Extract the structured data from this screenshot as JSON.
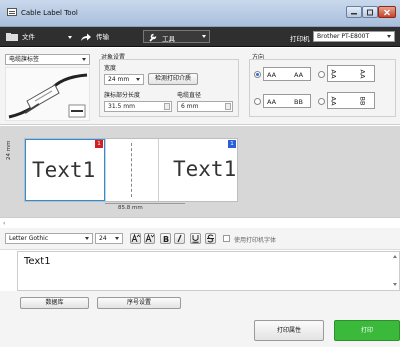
{
  "window": {
    "title": "Cable Label Tool"
  },
  "toolbar": {
    "file_label": "文件",
    "send_label": "传输",
    "tools_label": "工具",
    "printer_caption": "打印机",
    "printer_value": "Brother PT-E800T"
  },
  "settings": {
    "label_type": "电缆旗标签",
    "object_group_label": "对象设置",
    "width_label": "宽度",
    "width_value": "24 mm",
    "detect_button": "检测打印介质",
    "flag_length_label": "旗标部分长度",
    "flag_length_value": "31.5 mm",
    "cable_diameter_label": "电缆直径",
    "cable_diameter_value": "6 mm",
    "orientation_label": "方向",
    "orientation_options": [
      {
        "text_left": "AA",
        "text_right": "AA",
        "selected": true
      },
      {
        "text_left": "AA",
        "text_right": "AA",
        "selected": false,
        "rotated": true
      },
      {
        "text_left": "AA",
        "text_right": "BB",
        "selected": false
      },
      {
        "text_left": "AA",
        "text_right": "BB",
        "selected": false,
        "rotated": true
      }
    ]
  },
  "canvas": {
    "height_label": "24 mm",
    "text_left": "Text1",
    "text_right": "Text1",
    "badge_left": "1",
    "badge_right": "1",
    "width_label": "85.8 mm"
  },
  "format": {
    "font_value": "Letter Gothic",
    "size_value": "24",
    "use_printer_font_label": "使用打印机字体"
  },
  "editor": {
    "text": "Text1"
  },
  "buttons": {
    "database": "数据库",
    "numbering": "序号设置",
    "print_properties": "打印属性",
    "print": "打印"
  },
  "colors": {
    "accent": "#2a6fd6",
    "print_button": "#3bb93b",
    "badge_left": "#d21f1f",
    "badge_right": "#2a5fd8"
  }
}
